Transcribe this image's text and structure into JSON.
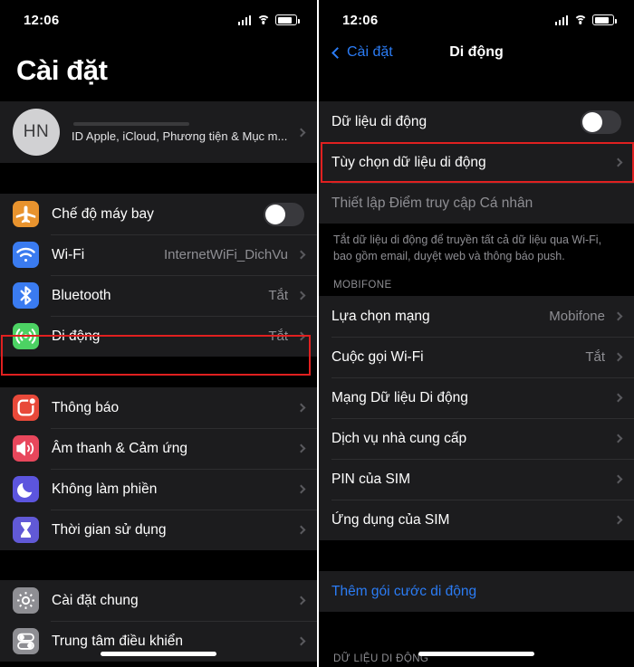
{
  "left_phone": {
    "status_bar": {
      "time": "12:06",
      "signal_icon": "cellular-signal-icon",
      "wifi_icon": "wifi-icon",
      "battery_icon": "battery-icon"
    },
    "title": "Cài đặt",
    "profile": {
      "initials": "HN",
      "subtitle": "ID Apple, iCloud, Phương tiện & Mục m...",
      "chevron": "chevron-right-icon"
    },
    "group1": [
      {
        "label": "Chế độ máy bay",
        "icon": "airplane-icon",
        "icon_color": "#e8932e",
        "control": "toggle",
        "toggle_on": false
      },
      {
        "label": "Wi-Fi",
        "icon": "wifi-icon",
        "icon_color": "#3a7bf0",
        "value": "InternetWiFi_DichVu",
        "control": "chevron"
      },
      {
        "label": "Bluetooth",
        "icon": "bluetooth-icon",
        "icon_color": "#3a7bf0",
        "value": "Tắt",
        "control": "chevron"
      },
      {
        "label": "Di động",
        "icon": "cellular-icon",
        "icon_color": "#4cd263",
        "value": "Tắt",
        "control": "chevron",
        "highlighted": true
      }
    ],
    "group2": [
      {
        "label": "Thông báo",
        "icon": "notification-icon",
        "icon_color": "#e8493a",
        "control": "chevron"
      },
      {
        "label": "Âm thanh & Cảm ứng",
        "icon": "sound-icon",
        "icon_color": "#e8475c",
        "control": "chevron"
      },
      {
        "label": "Không làm phiền",
        "icon": "moon-icon",
        "icon_color": "#5c55de",
        "control": "chevron"
      },
      {
        "label": "Thời gian sử dụng",
        "icon": "hourglass-icon",
        "icon_color": "#5c55de",
        "control": "chevron"
      }
    ],
    "group3": [
      {
        "label": "Cài đặt chung",
        "icon": "gear-icon",
        "icon_color": "#8e8e93",
        "control": "chevron"
      },
      {
        "label": "Trung tâm điều khiển",
        "icon": "control-center-icon",
        "icon_color": "#8e8e93",
        "control": "chevron"
      }
    ]
  },
  "right_phone": {
    "status_bar": {
      "time": "12:06",
      "signal_icon": "cellular-signal-icon",
      "wifi_icon": "wifi-icon",
      "battery_icon": "battery-icon"
    },
    "nav": {
      "back_label": "Cài đặt",
      "back_icon": "chevron-left-icon",
      "title": "Di động"
    },
    "group1": [
      {
        "label": "Dữ liệu di động",
        "control": "toggle",
        "toggle_on": false
      },
      {
        "label": "Tùy chọn dữ liệu di động",
        "control": "chevron",
        "highlighted": true
      },
      {
        "label": "Thiết lập Điểm truy cập Cá nhân",
        "control": "none",
        "muted": true
      }
    ],
    "note": "Tắt dữ liệu di động để truyền tất cả dữ liệu qua Wi-Fi, bao gồm email, duyệt web và thông báo push.",
    "section_header": "MOBIFONE",
    "group2": [
      {
        "label": "Lựa chọn mạng",
        "value": "Mobifone",
        "control": "chevron"
      },
      {
        "label": "Cuộc gọi Wi-Fi",
        "value": "Tắt",
        "control": "chevron"
      },
      {
        "label": "Mạng Dữ liệu Di động",
        "control": "chevron"
      },
      {
        "label": "Dịch vụ nhà cung cấp",
        "control": "chevron"
      },
      {
        "label": "PIN của SIM",
        "control": "chevron"
      },
      {
        "label": "Ứng dụng của SIM",
        "control": "chevron"
      }
    ],
    "group3": [
      {
        "label": "Thêm gói cước di động",
        "control": "none",
        "link": true
      }
    ],
    "bottom_section_header": "DỮ LIỆU DI ĐỘNG"
  },
  "colors": {
    "background": "#000000",
    "row_background": "#1c1c1e",
    "separator": "#2e2e30",
    "accent_blue": "#2b7cf5",
    "muted_text": "#8e8e93",
    "highlight_red": "#e02020"
  }
}
